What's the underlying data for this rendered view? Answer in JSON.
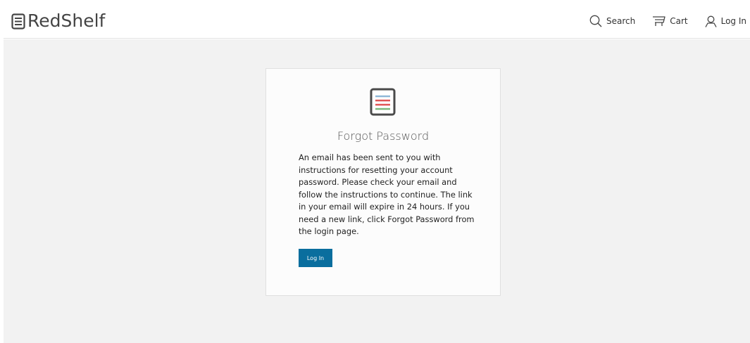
{
  "header": {
    "logo_text": "RedShelf",
    "nav": [
      {
        "label": "Search",
        "icon": "search-icon"
      },
      {
        "label": "Cart",
        "icon": "cart-icon"
      },
      {
        "label": "Log In",
        "icon": "user-icon"
      }
    ]
  },
  "card": {
    "icon": "book-list-icon",
    "title": "Forgot Password",
    "message": "An email has been sent to you with instructions for resetting your account password. Please check your email and follow the instructions to continue. The link in your email will expire in 24 hours. If you need a new link, click Forgot Password from the login page.",
    "button_label": "Log In"
  },
  "colors": {
    "brand_blue": "#0a6e9e",
    "icon_blue_line": "#8fb8d8",
    "icon_red_line": "#e05555",
    "icon_green_line": "#7cb87c",
    "background": "#f2f2f2"
  }
}
